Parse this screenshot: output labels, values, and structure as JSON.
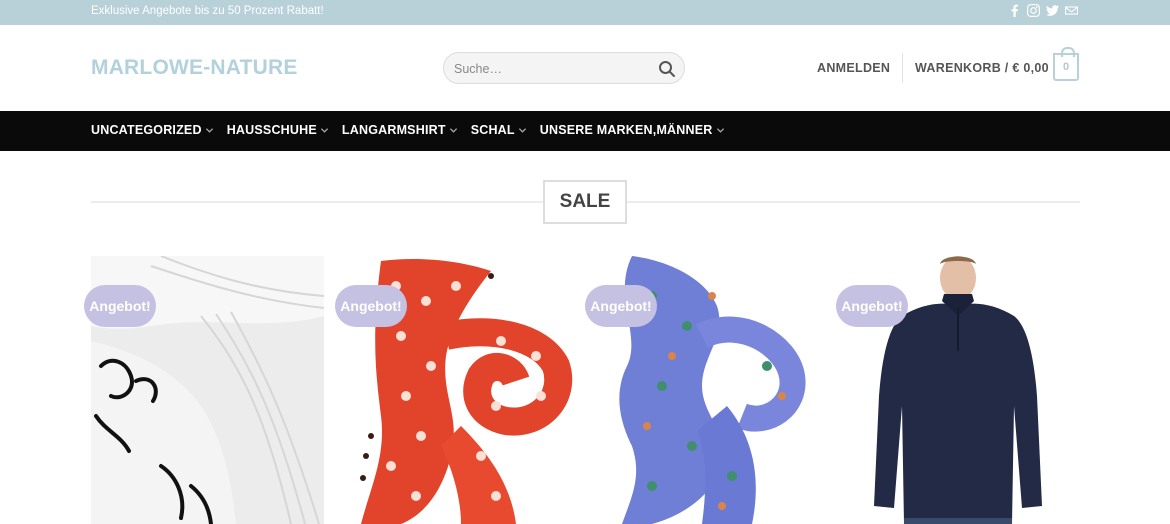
{
  "topbar": {
    "promo": "Exklusive Angebote bis zu 50 Prozent Rabatt!",
    "social_icons": [
      "facebook-icon",
      "instagram-icon",
      "twitter-icon",
      "mail-icon"
    ]
  },
  "header": {
    "logo": "MARLOWE-NATURE",
    "search_placeholder": "Suche…",
    "login": "ANMELDEN",
    "cart_label": "WARENKORB / € 0,00",
    "cart_count": "0"
  },
  "nav": {
    "items": [
      {
        "label": "UNCATEGORIZED"
      },
      {
        "label": "HAUSSCHUHE"
      },
      {
        "label": "LANGARMSHIRT"
      },
      {
        "label": "SCHAL"
      },
      {
        "label": "UNSERE MARKEN,MÄNNER"
      }
    ]
  },
  "section": {
    "title": "SALE"
  },
  "products": [
    {
      "badge": "Angebot!",
      "image": "white-socks-image"
    },
    {
      "badge": "Angebot!",
      "image": "red-floral-scarf-image"
    },
    {
      "badge": "Angebot!",
      "image": "blue-floral-scarf-image"
    },
    {
      "badge": "Angebot!",
      "image": "navy-sweater-model-image"
    }
  ],
  "colors": {
    "topbar": "#b8d0d8",
    "logo": "#b2d1dd",
    "nav_bg": "#0a0a0a",
    "badge": "#c4c1e2"
  }
}
